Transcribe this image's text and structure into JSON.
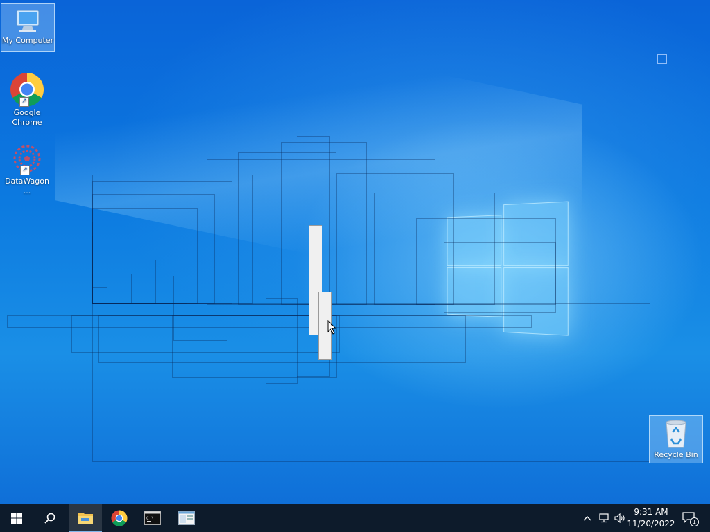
{
  "desktop": {
    "icons": [
      {
        "label": "My Computer",
        "icon": "computer-icon"
      },
      {
        "label": "Google Chrome",
        "icon": "chrome-icon"
      },
      {
        "label": "DataWagon ...",
        "icon": "datawagon-icon"
      },
      {
        "label": "Recycle Bin",
        "icon": "recycle-bin-icon"
      }
    ]
  },
  "taskbar": {
    "start_icon": "windows-start-icon",
    "search_icon": "search-icon",
    "apps": [
      {
        "name": "File Explorer",
        "icon": "folder-icon",
        "active": true
      },
      {
        "name": "Google Chrome",
        "icon": "chrome-icon",
        "active": false
      },
      {
        "name": "Command Prompt",
        "icon": "terminal-icon",
        "active": false
      },
      {
        "name": "App Window",
        "icon": "window-app-icon",
        "active": false
      }
    ],
    "tray": {
      "time": "9:31 AM",
      "date": "11/20/2022",
      "notification_count": "1"
    }
  },
  "colors": {
    "taskbar_bg": "#0d1b2b",
    "desktop_blue": "#0c7ae0",
    "accent": "#7fb6ea"
  }
}
